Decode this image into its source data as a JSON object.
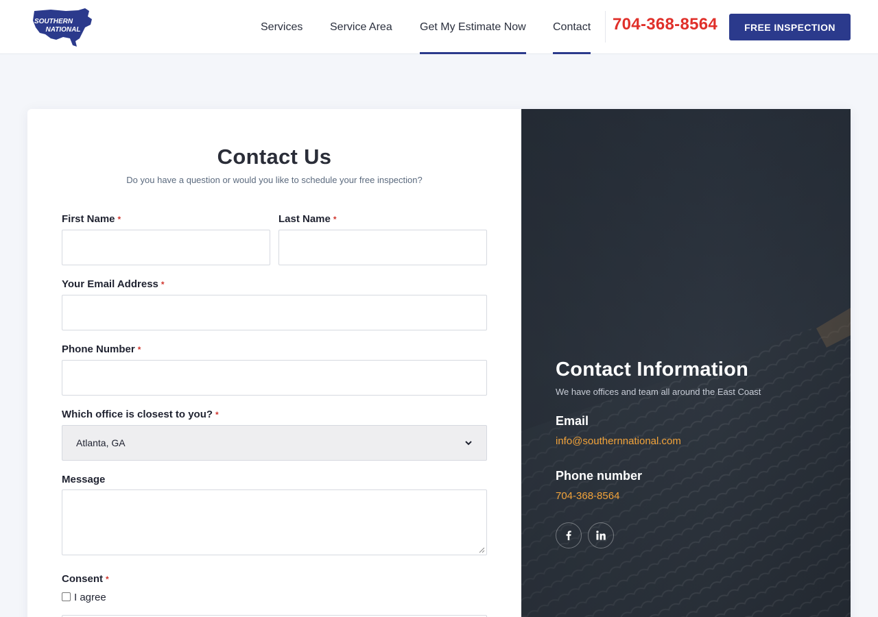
{
  "header": {
    "logo": {
      "line1": "SOUTHERN",
      "line2": "NATIONAL",
      "color": "#2b3a8c"
    },
    "nav": [
      {
        "label": "Services"
      },
      {
        "label": "Service Area"
      },
      {
        "label": "Get My Estimate Now",
        "active": true
      },
      {
        "label": "Contact",
        "active": true
      }
    ],
    "phone": "704-368-8564",
    "cta_label": "FREE INSPECTION"
  },
  "form": {
    "title": "Contact Us",
    "subtitle": "Do you have a question or would you like to schedule your free inspection?",
    "required_mark": "*",
    "first_name_label": "First Name",
    "last_name_label": "Last Name",
    "email_label": "Your Email Address",
    "phone_label": "Phone Number",
    "office_label": "Which office is closest to you?",
    "office_selected": "Atlanta, GA",
    "message_label": "Message",
    "consent_label": "Consent",
    "consent_option": "I agree"
  },
  "info": {
    "title": "Contact Information",
    "subtitle": "We have offices and team all around the East Coast",
    "email_heading": "Email",
    "email": "info@southernnational.com",
    "phone_heading": "Phone number",
    "phone": "704-368-8564",
    "social": [
      {
        "icon": "facebook-icon"
      },
      {
        "icon": "linkedin-icon"
      }
    ]
  },
  "colors": {
    "brand": "#2b3a8c",
    "phone_red": "#e0302a",
    "accent_orange": "#f2a33a",
    "required_red": "#d0342c"
  }
}
